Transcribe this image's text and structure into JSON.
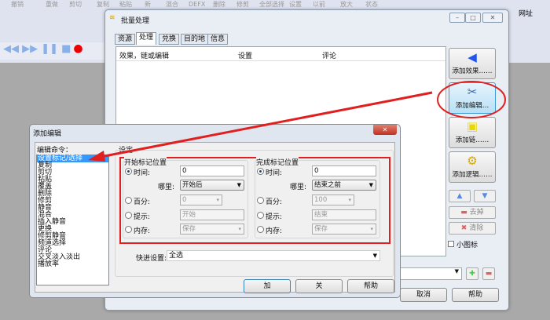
{
  "background_toolbar": {
    "labels": [
      "撤销",
      "重做",
      "剪切",
      "复制",
      "粘贴",
      "新",
      "混合",
      "DEFX",
      "删除",
      "修剪",
      "全部选择",
      "设置",
      "以前",
      "放大",
      "状态"
    ],
    "url_label": "网址"
  },
  "main_window": {
    "title": "批量处理",
    "tabs": [
      "资源",
      "处理",
      "兑换",
      "目的地",
      "信息"
    ],
    "active_tab": "处理",
    "columns": [
      "效果，链或编辑",
      "设置",
      "评论"
    ],
    "side_buttons": [
      "添加效果……",
      "添加编辑…",
      "添加链……",
      "添加逻辑……"
    ],
    "remove_label": "去掉",
    "clear_label": "清除",
    "small_icons_label": "小图标",
    "cancel_label": "取消",
    "help_label": "帮助"
  },
  "dialog": {
    "title": "添加编辑",
    "commands_label": "编辑命令：",
    "settings_label": "设定",
    "commands": [
      "设置标记/选择",
      "复制",
      "剪切",
      "粘贴",
      "覆盖",
      "删除",
      "修剪",
      "静音",
      "混合",
      "插入静音",
      "更换",
      "修剪静音",
      "频道选择",
      "评论",
      "交叉淡入淡出",
      "播放率"
    ],
    "selected_command": "设置标记/选择",
    "start": {
      "title": "开始标记位置",
      "time_label": "时间:",
      "time_value": "0",
      "where_label": "哪里:",
      "where_value": "开始后",
      "percent_label": "百分:",
      "percent_value": "0",
      "cue_label": "提示:",
      "cue_value": "开始",
      "memory_label": "内存:",
      "memory_value": "保存"
    },
    "end": {
      "title": "完成标记位置",
      "time_label": "时间:",
      "time_value": "0",
      "where_label": "哪里:",
      "where_value": "结束之前",
      "percent_label": "百分:",
      "percent_value": "100",
      "cue_label": "提示:",
      "cue_value": "结束",
      "memory_label": "内存:",
      "memory_value": "保存"
    },
    "quick_label": "快进设置:",
    "quick_value": "全选",
    "add_label": "加",
    "close_label": "关",
    "help_label": "帮助"
  },
  "colors": {
    "annotation": "#e02020",
    "selection": "#3399ff"
  }
}
